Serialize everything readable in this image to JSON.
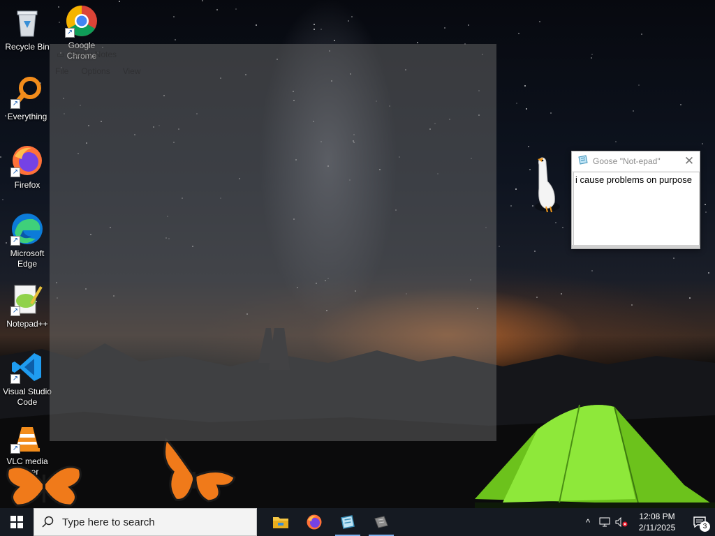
{
  "desktop": {
    "icons": [
      {
        "label": "Recycle Bin",
        "icon": "recycle-bin-icon"
      },
      {
        "label": "Google Chrome",
        "icon": "chrome-icon"
      },
      {
        "label": "Everything",
        "icon": "everything-search-icon"
      },
      {
        "label": "Firefox",
        "icon": "firefox-icon"
      },
      {
        "label": "Microsoft Edge",
        "icon": "edge-icon"
      },
      {
        "label": "Notepad++",
        "icon": "notepadpp-icon"
      },
      {
        "label": "Visual Studio Code",
        "icon": "vscode-icon"
      },
      {
        "label": "VLC media player",
        "icon": "vlc-icon"
      }
    ]
  },
  "ghost_window": {
    "title": "Sticky Notes",
    "menu": [
      "File",
      "Options",
      "View"
    ]
  },
  "notepad": {
    "title": "Goose \"Not-epad\"",
    "text": "i cause problems on purpose",
    "icon": "notepad-icon"
  },
  "taskbar": {
    "search_placeholder": "Type here to search",
    "apps": [
      {
        "name": "File Explorer",
        "icon": "file-explorer-icon",
        "active": false
      },
      {
        "name": "Firefox",
        "icon": "firefox-icon",
        "active": false
      },
      {
        "name": "Goose Notepad",
        "icon": "notepad-icon",
        "active": true
      },
      {
        "name": "Desktop Goose",
        "icon": "goose-app-icon",
        "active": true
      }
    ],
    "time": "12:08 PM",
    "date": "2/11/2025",
    "notification_count": "3"
  },
  "colors": {
    "taskbar": "#151a22",
    "accent": "#7fb2ee",
    "tent_green": "#7ed321"
  }
}
